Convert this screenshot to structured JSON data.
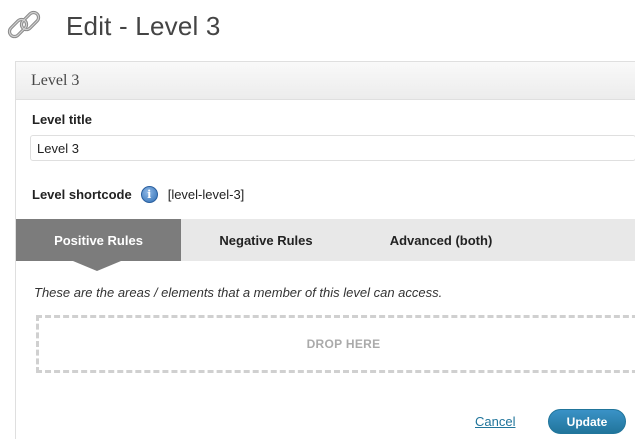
{
  "header": {
    "title": "Edit - Level 3",
    "icon": "chain-link-icon"
  },
  "panel": {
    "title": "Level 3",
    "level_title_label": "Level title",
    "level_title_value": "Level 3",
    "shortcode_label": "Level shortcode",
    "shortcode_value": "[level-level-3]",
    "info_glyph": "i"
  },
  "tabs": [
    {
      "label": "Positive Rules",
      "active": true
    },
    {
      "label": "Negative Rules",
      "active": false
    },
    {
      "label": "Advanced (both)",
      "active": false
    }
  ],
  "rules": {
    "description": "These are the areas / elements that a member of this level can access.",
    "drop_text": "DROP HERE"
  },
  "actions": {
    "cancel_label": "Cancel",
    "update_label": "Update"
  },
  "colors": {
    "accent": "#21759b",
    "active_tab": "#7c7c7c",
    "tab_bar": "#e8e8e8"
  }
}
